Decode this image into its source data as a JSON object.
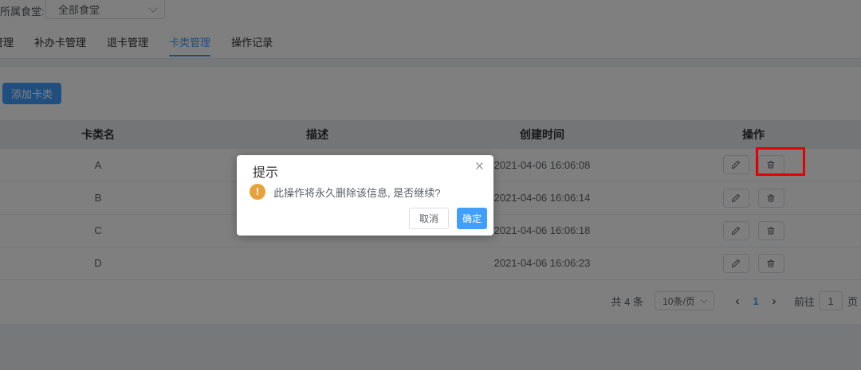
{
  "filter": {
    "label": "所属食堂:",
    "select_value": "全部食堂"
  },
  "tabs": [
    {
      "label": "管理",
      "active": false
    },
    {
      "label": "补办卡管理",
      "active": false
    },
    {
      "label": "退卡管理",
      "active": false
    },
    {
      "label": "卡类管理",
      "active": true
    },
    {
      "label": "操作记录",
      "active": false
    }
  ],
  "toolbar": {
    "add_button": "添加卡类"
  },
  "table": {
    "columns": [
      "卡类名",
      "描述",
      "创建时间",
      "操作"
    ],
    "rows": [
      {
        "name": "A",
        "desc": "",
        "created": "2021-04-06 16:06:08"
      },
      {
        "name": "B",
        "desc": "",
        "created": "2021-04-06 16:06:14"
      },
      {
        "name": "C",
        "desc": "",
        "created": "2021-04-06 16:06:18"
      },
      {
        "name": "D",
        "desc": "",
        "created": "2021-04-06 16:06:23"
      }
    ]
  },
  "pagination": {
    "total": "共 4 条",
    "page_size": "10条/页",
    "prev": "‹",
    "current_page": "1",
    "next": "›",
    "goto_label": "前往",
    "goto_value": "1",
    "goto_suffix": "页"
  },
  "dialog": {
    "title": "提示",
    "close": "×",
    "warning_mark": "!",
    "message": "此操作将永久删除该信息, 是否继续?",
    "cancel": "取消",
    "confirm": "确定"
  },
  "colors": {
    "primary": "#409EFF",
    "warning": "#E6A23C",
    "annotation": "#e60000"
  }
}
